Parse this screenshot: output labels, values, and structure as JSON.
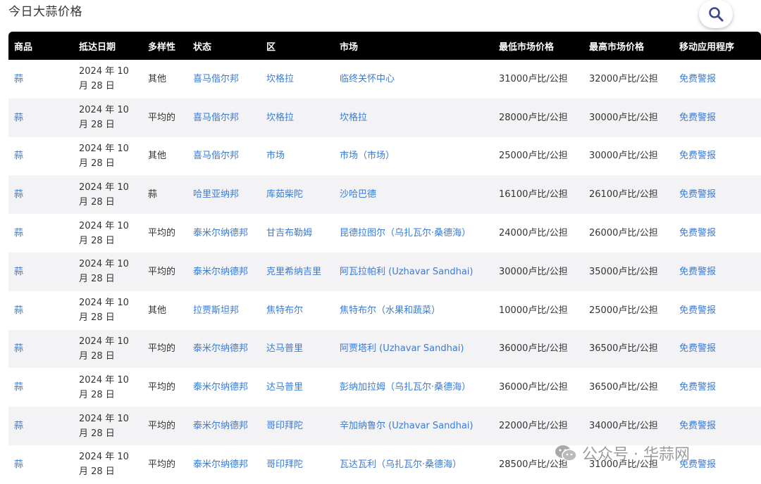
{
  "page": {
    "title": "今日大蒜价格"
  },
  "search": {
    "icon": "search-icon"
  },
  "table": {
    "headers": [
      "商品",
      "抵达日期",
      "多样性",
      "状态",
      "区",
      "市场",
      "最低市场价格",
      "最高市场价格",
      "移动应用程序"
    ],
    "rows": [
      [
        "蒜",
        "2024 年 10 月 28 日",
        "其他",
        "喜马偕尔邦",
        "坎格拉",
        "临终关怀中心",
        "31000卢比/公担",
        "32000卢比/公担",
        "免费警报"
      ],
      [
        "蒜",
        "2024 年 10 月 28 日",
        "平均的",
        "喜马偕尔邦",
        "坎格拉",
        "坎格拉",
        "28000卢比/公担",
        "30000卢比/公担",
        "免费警报"
      ],
      [
        "蒜",
        "2024 年 10 月 28 日",
        "其他",
        "喜马偕尔邦",
        "市场",
        "市场（市场）",
        "25000卢比/公担",
        "30000卢比/公担",
        "免费警报"
      ],
      [
        "蒜",
        "2024 年 10 月 28 日",
        "蒜",
        "哈里亚纳邦",
        "库茹柴陀",
        "沙哈巴德",
        "16100卢比/公担",
        "26100卢比/公担",
        "免费警报"
      ],
      [
        "蒜",
        "2024 年 10 月 28 日",
        "平均的",
        "泰米尔纳德邦",
        "甘吉布勒姆",
        "昆德拉图尔（乌扎瓦尔·桑德海）",
        "24000卢比/公担",
        "26000卢比/公担",
        "免费警报"
      ],
      [
        "蒜",
        "2024 年 10 月 28 日",
        "平均的",
        "泰米尔纳德邦",
        "克里希纳吉里",
        "阿瓦拉帕利 (Uzhavar Sandhai)",
        "30000卢比/公担",
        "35000卢比/公担",
        "免费警报"
      ],
      [
        "蒜",
        "2024 年 10 月 28 日",
        "其他",
        "拉贾斯坦邦",
        "焦特布尔",
        "焦特布尔（水果和蔬菜）",
        "10000卢比/公担",
        "25000卢比/公担",
        "免费警报"
      ],
      [
        "蒜",
        "2024 年 10 月 28 日",
        "平均的",
        "泰米尔纳德邦",
        "达马普里",
        "阿贾塔利 (Uzhavar Sandhai)",
        "36000卢比/公担",
        "36500卢比/公担",
        "免费警报"
      ],
      [
        "蒜",
        "2024 年 10 月 28 日",
        "平均的",
        "泰米尔纳德邦",
        "达马普里",
        "彭纳加拉姆（乌扎瓦尔·桑德海）",
        "36000卢比/公担",
        "36500卢比/公担",
        "免费警报"
      ],
      [
        "蒜",
        "2024 年 10 月 28 日",
        "平均的",
        "泰米尔纳德邦",
        "哥印拜陀",
        "辛加纳鲁尔 (Uzhavar Sandhai)",
        "22000卢比/公担",
        "34000卢比/公担",
        "免费警报"
      ],
      [
        "蒜",
        "2024 年 10 月 28 日",
        "平均的",
        "泰米尔纳德邦",
        "哥印拜陀",
        "瓦达瓦利（乌扎瓦尔·桑德海）",
        "28500卢比/公担",
        "31000卢比/公担",
        "免费警报"
      ]
    ]
  },
  "watermark": {
    "text": "公众号 · 华蒜网",
    "icon": "wechat-icon"
  },
  "colors": {
    "header_bg": "#000000",
    "link": "#3a7bd5",
    "row_alt": "#f3f3f6"
  }
}
